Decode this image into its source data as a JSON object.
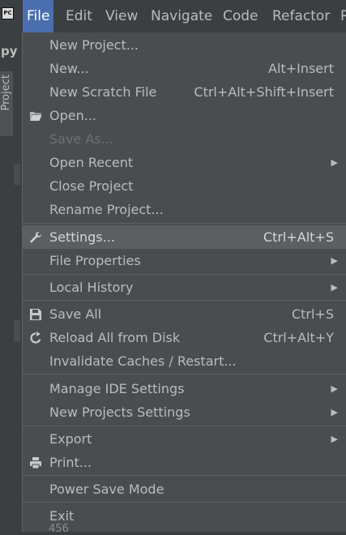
{
  "app_icon": "PC",
  "menubar": {
    "items": [
      "File",
      "Edit",
      "View",
      "Navigate",
      "Code",
      "Refactor",
      "R"
    ]
  },
  "left_panel": {
    "project_prefix": "py",
    "tab_label": "Project"
  },
  "file_menu": {
    "new_project": "New Project...",
    "new": "New...",
    "new_shortcut": "Alt+Insert",
    "new_scratch": "New Scratch File",
    "new_scratch_shortcut": "Ctrl+Alt+Shift+Insert",
    "open": "Open...",
    "save_as": "Save As...",
    "open_recent": "Open Recent",
    "close_project": "Close Project",
    "rename_project": "Rename Project...",
    "settings": "Settings...",
    "settings_shortcut": "Ctrl+Alt+S",
    "file_properties": "File Properties",
    "local_history": "Local History",
    "save_all": "Save All",
    "save_all_shortcut": "Ctrl+S",
    "reload": "Reload All from Disk",
    "reload_shortcut": "Ctrl+Alt+Y",
    "invalidate": "Invalidate Caches / Restart...",
    "manage_ide": "Manage IDE Settings",
    "new_projects_settings": "New Projects Settings",
    "export": "Export",
    "print": "Print...",
    "power_save": "Power Save Mode",
    "exit": "Exit"
  },
  "bottom_peek": "456",
  "colors": {
    "menubar_bg": "#3c3f41",
    "menu_bg": "#4a4d50",
    "selected_bg": "#5c5f61",
    "active_title_bg": "#4b6eaf",
    "text": "#bbbbbb",
    "disabled_text": "#6e7072"
  },
  "icons": {
    "open": "folder-icon",
    "settings": "wrench-icon",
    "save_all": "floppy-disk-icon",
    "reload": "reload-icon",
    "print": "printer-icon",
    "submenu": "chevron-right-icon"
  }
}
